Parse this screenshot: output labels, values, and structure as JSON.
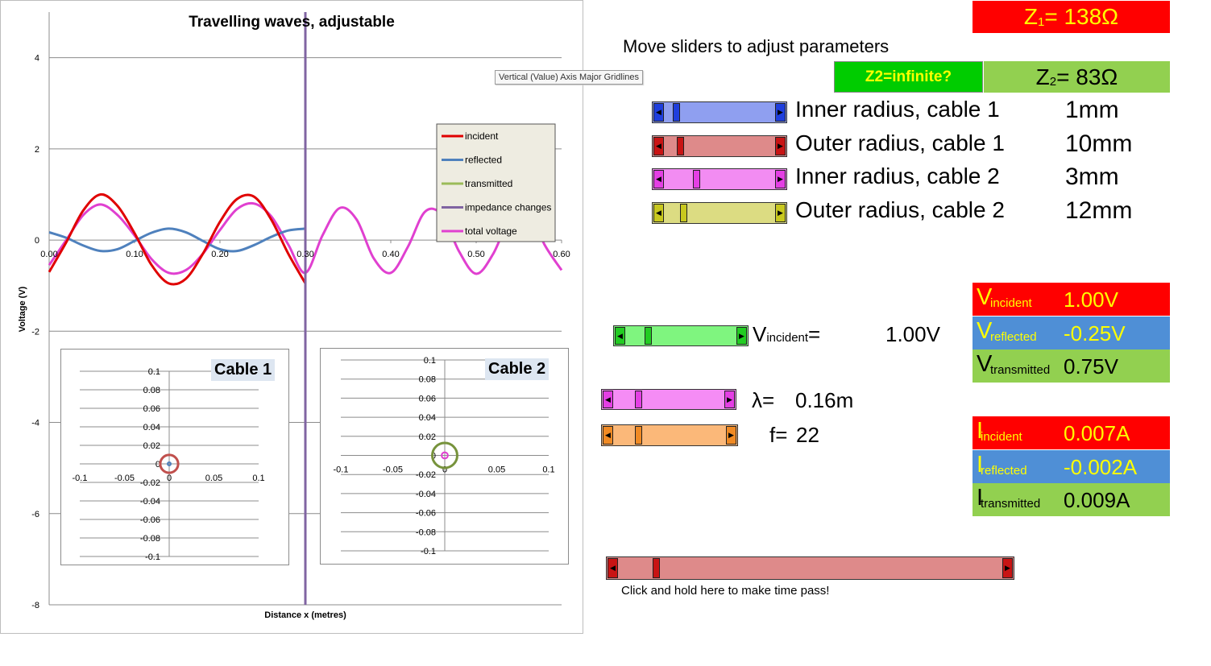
{
  "chart_data": {
    "type": "line",
    "title": "Travelling waves, adjustable",
    "xlabel": "Distance x (metres)",
    "ylabel": "Voltage (V)",
    "xlim": [
      0,
      0.6
    ],
    "ylim": [
      -8,
      5
    ],
    "x_ticks": [
      "0.00",
      "0.10",
      "0.20",
      "0.30",
      "0.40",
      "0.50",
      "0.60"
    ],
    "y_ticks": [
      "4",
      "2",
      "0",
      "-2",
      "-4",
      "-6",
      "-8"
    ],
    "grid": true,
    "legend_position": "right",
    "series": [
      {
        "name": "incident",
        "color": "#e00000",
        "x": [
          0.0,
          0.02,
          0.04,
          0.06,
          0.08,
          0.1,
          0.12,
          0.14,
          0.16,
          0.18,
          0.2,
          0.22,
          0.24,
          0.26,
          0.28,
          0.3
        ],
        "y": [
          -0.7,
          -0.05,
          0.65,
          1.0,
          0.75,
          0.15,
          -0.55,
          -0.95,
          -0.85,
          -0.3,
          0.4,
          0.9,
          0.95,
          0.45,
          -0.3,
          -0.95
        ]
      },
      {
        "name": "reflected",
        "color": "#4f81bd",
        "x": [
          0.0,
          0.02,
          0.04,
          0.06,
          0.08,
          0.1,
          0.12,
          0.14,
          0.16,
          0.18,
          0.2,
          0.22,
          0.24,
          0.26,
          0.28,
          0.3
        ],
        "y": [
          0.17,
          0.05,
          -0.12,
          -0.24,
          -0.2,
          -0.02,
          0.16,
          0.25,
          0.17,
          -0.02,
          -0.2,
          -0.24,
          -0.11,
          0.07,
          0.21,
          0.25
        ]
      },
      {
        "name": "transmitted",
        "color": "#9bbb59",
        "x": [],
        "y": []
      },
      {
        "name": "impedance changes",
        "color": "#8064a2",
        "x": [
          0.3,
          0.3
        ],
        "y": [
          5,
          -8
        ]
      },
      {
        "name": "total voltage",
        "color": "#e040d0",
        "x": [
          0.0,
          0.02,
          0.04,
          0.06,
          0.08,
          0.1,
          0.12,
          0.14,
          0.16,
          0.18,
          0.2,
          0.22,
          0.24,
          0.26,
          0.28,
          0.3,
          0.32,
          0.34,
          0.36,
          0.38,
          0.4,
          0.42,
          0.44,
          0.46,
          0.48,
          0.5,
          0.52,
          0.54,
          0.56,
          0.58,
          0.6
        ],
        "y": [
          -0.55,
          0.0,
          0.55,
          0.78,
          0.55,
          0.1,
          -0.42,
          -0.72,
          -0.66,
          -0.3,
          0.22,
          0.68,
          0.8,
          0.52,
          -0.1,
          -0.72,
          0.1,
          0.7,
          0.45,
          -0.4,
          -0.72,
          -0.15,
          0.62,
          0.55,
          -0.25,
          -0.74,
          -0.3,
          0.5,
          0.7,
          -0.1,
          -0.66
        ]
      }
    ]
  },
  "tooltip": "Vertical (Value) Axis Major Gridlines",
  "cable1": {
    "title": "Cable 1",
    "y_ticks": [
      "0.1",
      "0.08",
      "0.06",
      "0.04",
      "0.02",
      "0",
      "-0.02",
      "-0.04",
      "-0.06",
      "-0.08",
      "-0.1"
    ],
    "x_ticks": [
      "-0.1",
      "-0.05",
      "0",
      "0.05",
      "0.1"
    ],
    "inner_color": "#4f81bd",
    "outer_color": "#c0504d",
    "inner_radius_mm": 1,
    "outer_radius_mm": 10
  },
  "cable2": {
    "title": "Cable 2",
    "y_ticks": [
      "0.1",
      "0.08",
      "0.06",
      "0.04",
      "0.02",
      "0",
      "-0.02",
      "-0.04",
      "-0.06",
      "-0.08",
      "-0.1"
    ],
    "x_ticks": [
      "-0.1",
      "-0.05",
      "0",
      "0.05",
      "0.1"
    ],
    "inner_color": "#e040d0",
    "outer_color": "#77933c",
    "inner_radius_mm": 3,
    "outer_radius_mm": 12
  },
  "z1": {
    "label": "Z",
    "sub": "1",
    "value": "= 138Ω"
  },
  "z2": {
    "label": "Z",
    "sub": "2",
    "value": "= 83Ω"
  },
  "instruction": "Move sliders to adjust parameters",
  "z2_infinite_button": "Z2=infinite?",
  "sliders": [
    {
      "label": "Inner radius, cable 1",
      "value": "1mm",
      "color": "#8f9ff0",
      "btn": "#1f3fdd",
      "pos": 0.08
    },
    {
      "label": "Outer radius, cable 1",
      "value": "10mm",
      "color": "#de8a8a",
      "btn": "#c81414",
      "pos": 0.12
    },
    {
      "label": "Inner radius, cable 2",
      "value": "3mm",
      "color": "#f28cf2",
      "btn": "#e43fe4",
      "pos": 0.27
    },
    {
      "label": "Outer radius, cable 2",
      "value": "12mm",
      "color": "#dcdc82",
      "btn": "#c8c81e",
      "pos": 0.15
    }
  ],
  "v_incident_control": {
    "label": "V",
    "sub": "incident",
    "suffix": "=",
    "value": "1.00V",
    "pos": 0.18
  },
  "wavelength": {
    "label": "λ=",
    "value": "0.16m",
    "pos": 0.2
  },
  "frequency": {
    "label": "f=",
    "value": "22",
    "pos": 0.2
  },
  "voltages": [
    {
      "sym": "V",
      "sub": "incident",
      "value": "1.00V",
      "bg": "#ff0000",
      "fg": "#ffff00"
    },
    {
      "sym": "V",
      "sub": "reflected",
      "value": "-0.25V",
      "bg": "#4f8fd6",
      "fg": "#ffff00"
    },
    {
      "sym": "V",
      "sub": "transmitted",
      "value": "0.75V",
      "bg": "#92d050",
      "fg": "#000000"
    }
  ],
  "currents": [
    {
      "sym": "I",
      "sub": "incident",
      "value": "0.007A",
      "bg": "#ff0000",
      "fg": "#ffff00"
    },
    {
      "sym": "I",
      "sub": "reflected",
      "value": "-0.002A",
      "bg": "#4f8fd6",
      "fg": "#ffff00"
    },
    {
      "sym": "I",
      "sub": "transmitted",
      "value": "0.009A",
      "bg": "#92d050",
      "fg": "#000000"
    }
  ],
  "time_slider": {
    "label": "Click and hold here to make time pass!",
    "pos": 0.09
  }
}
